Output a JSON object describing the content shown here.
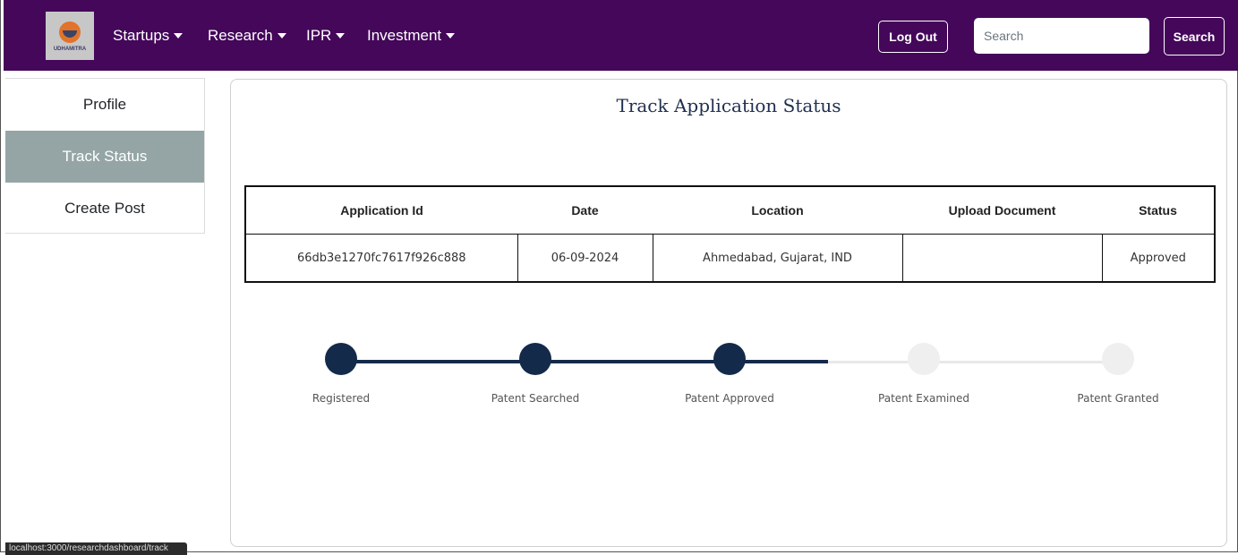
{
  "navbar": {
    "logo_text": "UDHAMITRA",
    "items": [
      {
        "label": "Startups"
      },
      {
        "label": "Research"
      },
      {
        "label": "IPR"
      },
      {
        "label": "Investment"
      }
    ],
    "logout_label": "Log Out",
    "search_placeholder": "Search",
    "search_button_label": "Search",
    "colors": {
      "background": "#44075a"
    }
  },
  "sidebar": {
    "items": [
      {
        "label": "Profile",
        "active": false
      },
      {
        "label": "Track Status",
        "active": true
      },
      {
        "label": "Create Post",
        "active": false
      }
    ],
    "active_color": "#95a5a6"
  },
  "main": {
    "title": "Track Application Status",
    "table": {
      "headers": [
        "Application Id",
        "Date",
        "Location",
        "Upload Document",
        "Status"
      ],
      "rows": [
        [
          "66db3e1270fc7617f926c888",
          "06-09-2024",
          "Ahmedabad, Gujarat, IND",
          "",
          "Approved"
        ]
      ]
    },
    "stepper": {
      "steps": [
        {
          "label": "Registered",
          "completed": true
        },
        {
          "label": "Patent Searched",
          "completed": true
        },
        {
          "label": "Patent Approved",
          "completed": true
        },
        {
          "label": "Patent Examined",
          "completed": false
        },
        {
          "label": "Patent Granted",
          "completed": false
        }
      ],
      "completed_color": "#142a4a"
    }
  },
  "statusbar": {
    "url": "localhost:3000/researchdashboard/track"
  }
}
